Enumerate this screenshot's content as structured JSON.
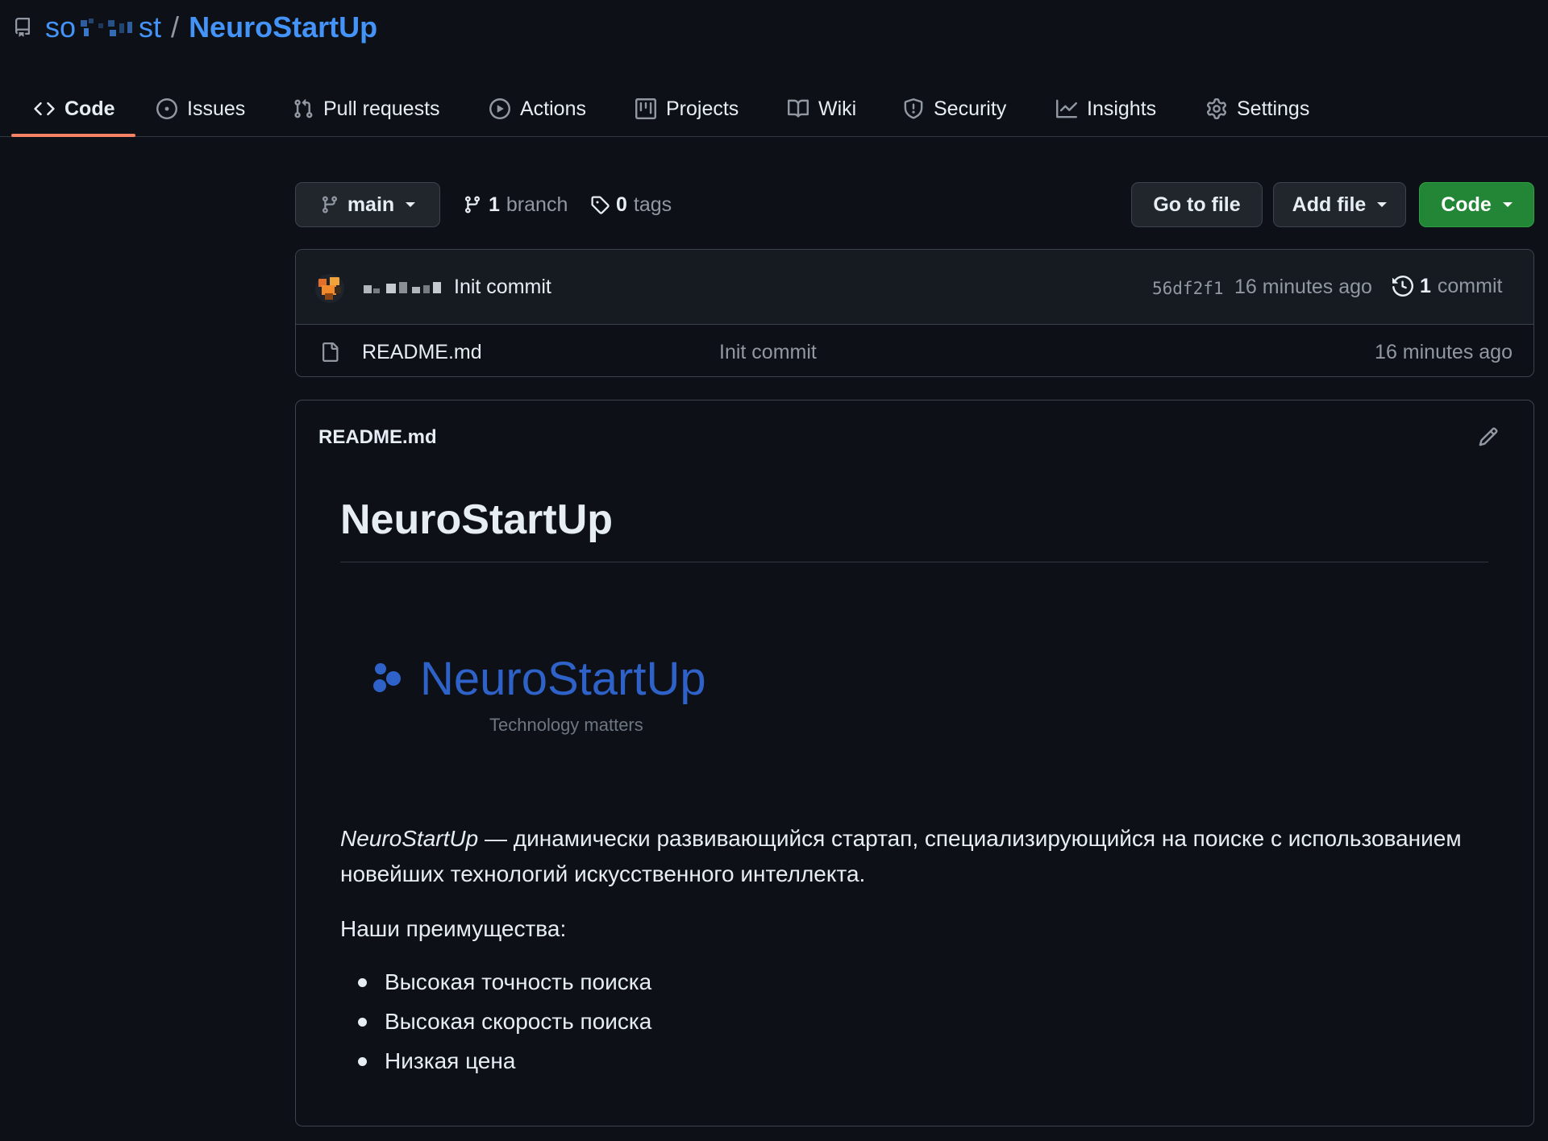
{
  "repo": {
    "owner": "so[blurred]st",
    "separator": "/",
    "name": "NeuroStartUp"
  },
  "tabs": [
    {
      "label": "Code",
      "icon": "code-icon",
      "active": true
    },
    {
      "label": "Issues",
      "icon": "issue-opened-icon"
    },
    {
      "label": "Pull requests",
      "icon": "git-pull-request-icon"
    },
    {
      "label": "Actions",
      "icon": "play-icon"
    },
    {
      "label": "Projects",
      "icon": "table-icon"
    },
    {
      "label": "Wiki",
      "icon": "book-icon"
    },
    {
      "label": "Security",
      "icon": "shield-icon"
    },
    {
      "label": "Insights",
      "icon": "graph-icon"
    },
    {
      "label": "Settings",
      "icon": "gear-icon"
    }
  ],
  "branch_bar": {
    "branch": "main",
    "branch_count": "1",
    "branch_word": "branch",
    "tag_count": "0",
    "tag_word": "tags",
    "go_to_file": "Go to file",
    "add_file": "Add file",
    "code": "Code"
  },
  "latest_commit": {
    "author": "[blurred]",
    "message": "Init commit",
    "sha": "56df2f1",
    "time": "16 minutes ago",
    "count": "1",
    "count_word": "commit"
  },
  "files": [
    {
      "name": "README.md",
      "commit": "Init commit",
      "time": "16 minutes ago"
    }
  ],
  "readme": {
    "filename": "README.md",
    "heading": "NeuroStartUp",
    "logo": {
      "name": "NeuroStartUp",
      "tagline": "Technology matters"
    },
    "intro_em": "NeuroStartUp",
    "intro_rest": " — динамически развивающийся стартап, специализирующийся на поиске с использованием новейших технологий искусственного интеллекта.",
    "advantages_label": "Наши преимущества:",
    "advantages": [
      "Высокая точность поиска",
      "Высокая скорость поиска",
      "Низкая цена"
    ]
  },
  "colors": {
    "background": "#0d1117",
    "link": "#4493f8",
    "accent_underline": "#f78166",
    "primary_button": "#238636",
    "logo_blue": "#2f62c9"
  }
}
